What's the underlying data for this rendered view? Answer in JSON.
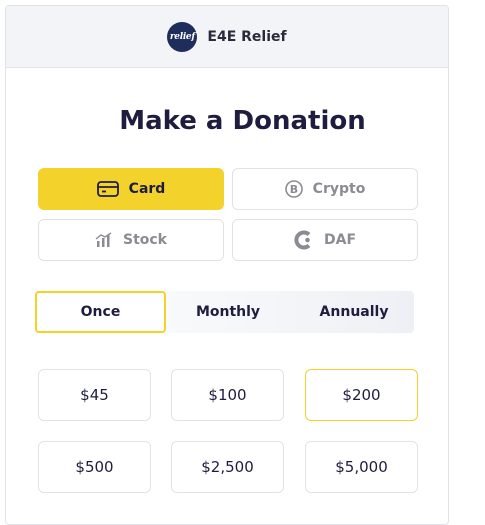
{
  "header": {
    "logo_text": "relief",
    "brand_name": "E4E Relief"
  },
  "title": "Make a Donation",
  "methods": [
    {
      "label": "Card",
      "icon": "credit-card-icon",
      "active": true
    },
    {
      "label": "Crypto",
      "icon": "bitcoin-icon",
      "active": false
    },
    {
      "label": "Stock",
      "icon": "stock-chart-icon",
      "active": false
    },
    {
      "label": "DAF",
      "icon": "daf-icon",
      "active": false
    }
  ],
  "frequency": {
    "options": [
      "Once",
      "Monthly",
      "Annually"
    ],
    "selected": "Once"
  },
  "amounts": {
    "options": [
      "$45",
      "$100",
      "$200",
      "$500",
      "$2,500",
      "$5,000"
    ],
    "selected": "$200"
  },
  "colors": {
    "accent": "#f3d22b",
    "text_dark": "#1f1d3f",
    "muted": "#8b8b92",
    "header_bg": "#f3f4f8",
    "logo_bg": "#1f2d5c"
  }
}
